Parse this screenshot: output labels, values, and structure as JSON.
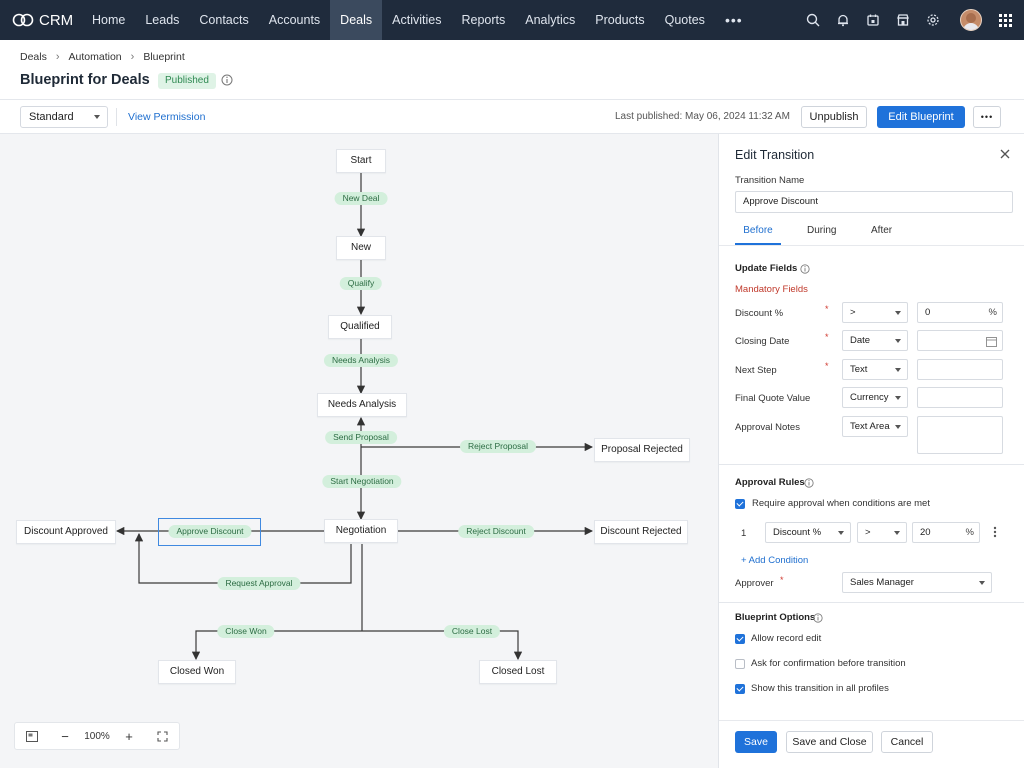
{
  "nav": {
    "brand": "CRM",
    "items": [
      "Home",
      "Leads",
      "Contacts",
      "Accounts",
      "Deals",
      "Activities",
      "Reports",
      "Analytics",
      "Products",
      "Quotes"
    ],
    "active": "Deals",
    "more": "•••"
  },
  "breadcrumb": [
    "Deals",
    "Automation",
    "Blueprint"
  ],
  "page": {
    "title": "Blueprint for Deals",
    "status": "Published"
  },
  "toolbar": {
    "layout_select": "Standard",
    "view_permission": "View Permission",
    "last_published": "Last published: May 06, 2024 11:32 AM",
    "unpublish": "Unpublish",
    "edit_blueprint": "Edit Blueprint",
    "more": "•••"
  },
  "flow": {
    "nodes": {
      "start": "Start",
      "new": "New",
      "qualified": "Qualified",
      "needs_analysis": "Needs Analysis",
      "proposal_rejected": "Proposal Rejected",
      "negotiation": "Negotiation",
      "discount_approved": "Discount Approved",
      "discount_rejected": "Discount Rejected",
      "closed_won": "Closed Won",
      "closed_lost": "Closed Lost"
    },
    "transitions": {
      "new_deal": "New Deal",
      "qualify": "Qualify",
      "needs_analysis": "Needs Analysis",
      "send_proposal": "Send Proposal",
      "reject_proposal": "Reject Proposal",
      "start_negotiation": "Start Negotiation",
      "approve_discount": "Approve Discount",
      "reject_discount": "Reject Discount",
      "request_approval": "Request Approval",
      "close_won": "Close Won",
      "close_lost": "Close Lost"
    }
  },
  "zoom": {
    "level": "100%",
    "minus": "−",
    "plus": "+"
  },
  "panel": {
    "title": "Edit Transition",
    "transition_name_label": "Transition Name",
    "transition_name_value": "Approve Discount",
    "tabs": [
      "Before",
      "During",
      "After"
    ],
    "active_tab": "Before",
    "update_fields_title": "Update Fields",
    "mandatory_fields": "Mandatory Fields",
    "fields": [
      {
        "label": "Discount %",
        "required": true,
        "type": ">",
        "value": "0",
        "suffix": "%"
      },
      {
        "label": "Closing Date",
        "required": true,
        "type": "Date",
        "value": ""
      },
      {
        "label": "Next Step",
        "required": true,
        "type": "Text",
        "value": ""
      },
      {
        "label": "Final Quote Value",
        "required": false,
        "type": "Currency",
        "value": ""
      },
      {
        "label": "Approval Notes",
        "required": false,
        "type": "Text Area",
        "value": ""
      }
    ],
    "approval_rules_title": "Approval Rules",
    "require_approval_label": "Require approval when conditions are met",
    "condition": {
      "index": "1",
      "field": "Discount %",
      "operator": ">",
      "value": "20",
      "suffix": "%"
    },
    "add_condition": "+ Add Condition",
    "approver_label": "Approver",
    "approver_value": "Sales Manager",
    "options_title": "Blueprint Options",
    "options": [
      {
        "label": "Allow record edit",
        "checked": true
      },
      {
        "label": "Ask for confirmation before transition",
        "checked": false
      },
      {
        "label": "Show this transition in all profiles",
        "checked": true
      }
    ],
    "save": "Save",
    "save_close": "Save and Close",
    "cancel": "Cancel"
  },
  "colors": {
    "nav_bg": "#1f2b3c",
    "primary": "#1f72da",
    "pill_bg": "#d3efdc",
    "pill_text": "#2c6c43",
    "badge_bg": "#dff3e6",
    "required": "#d0392f"
  }
}
